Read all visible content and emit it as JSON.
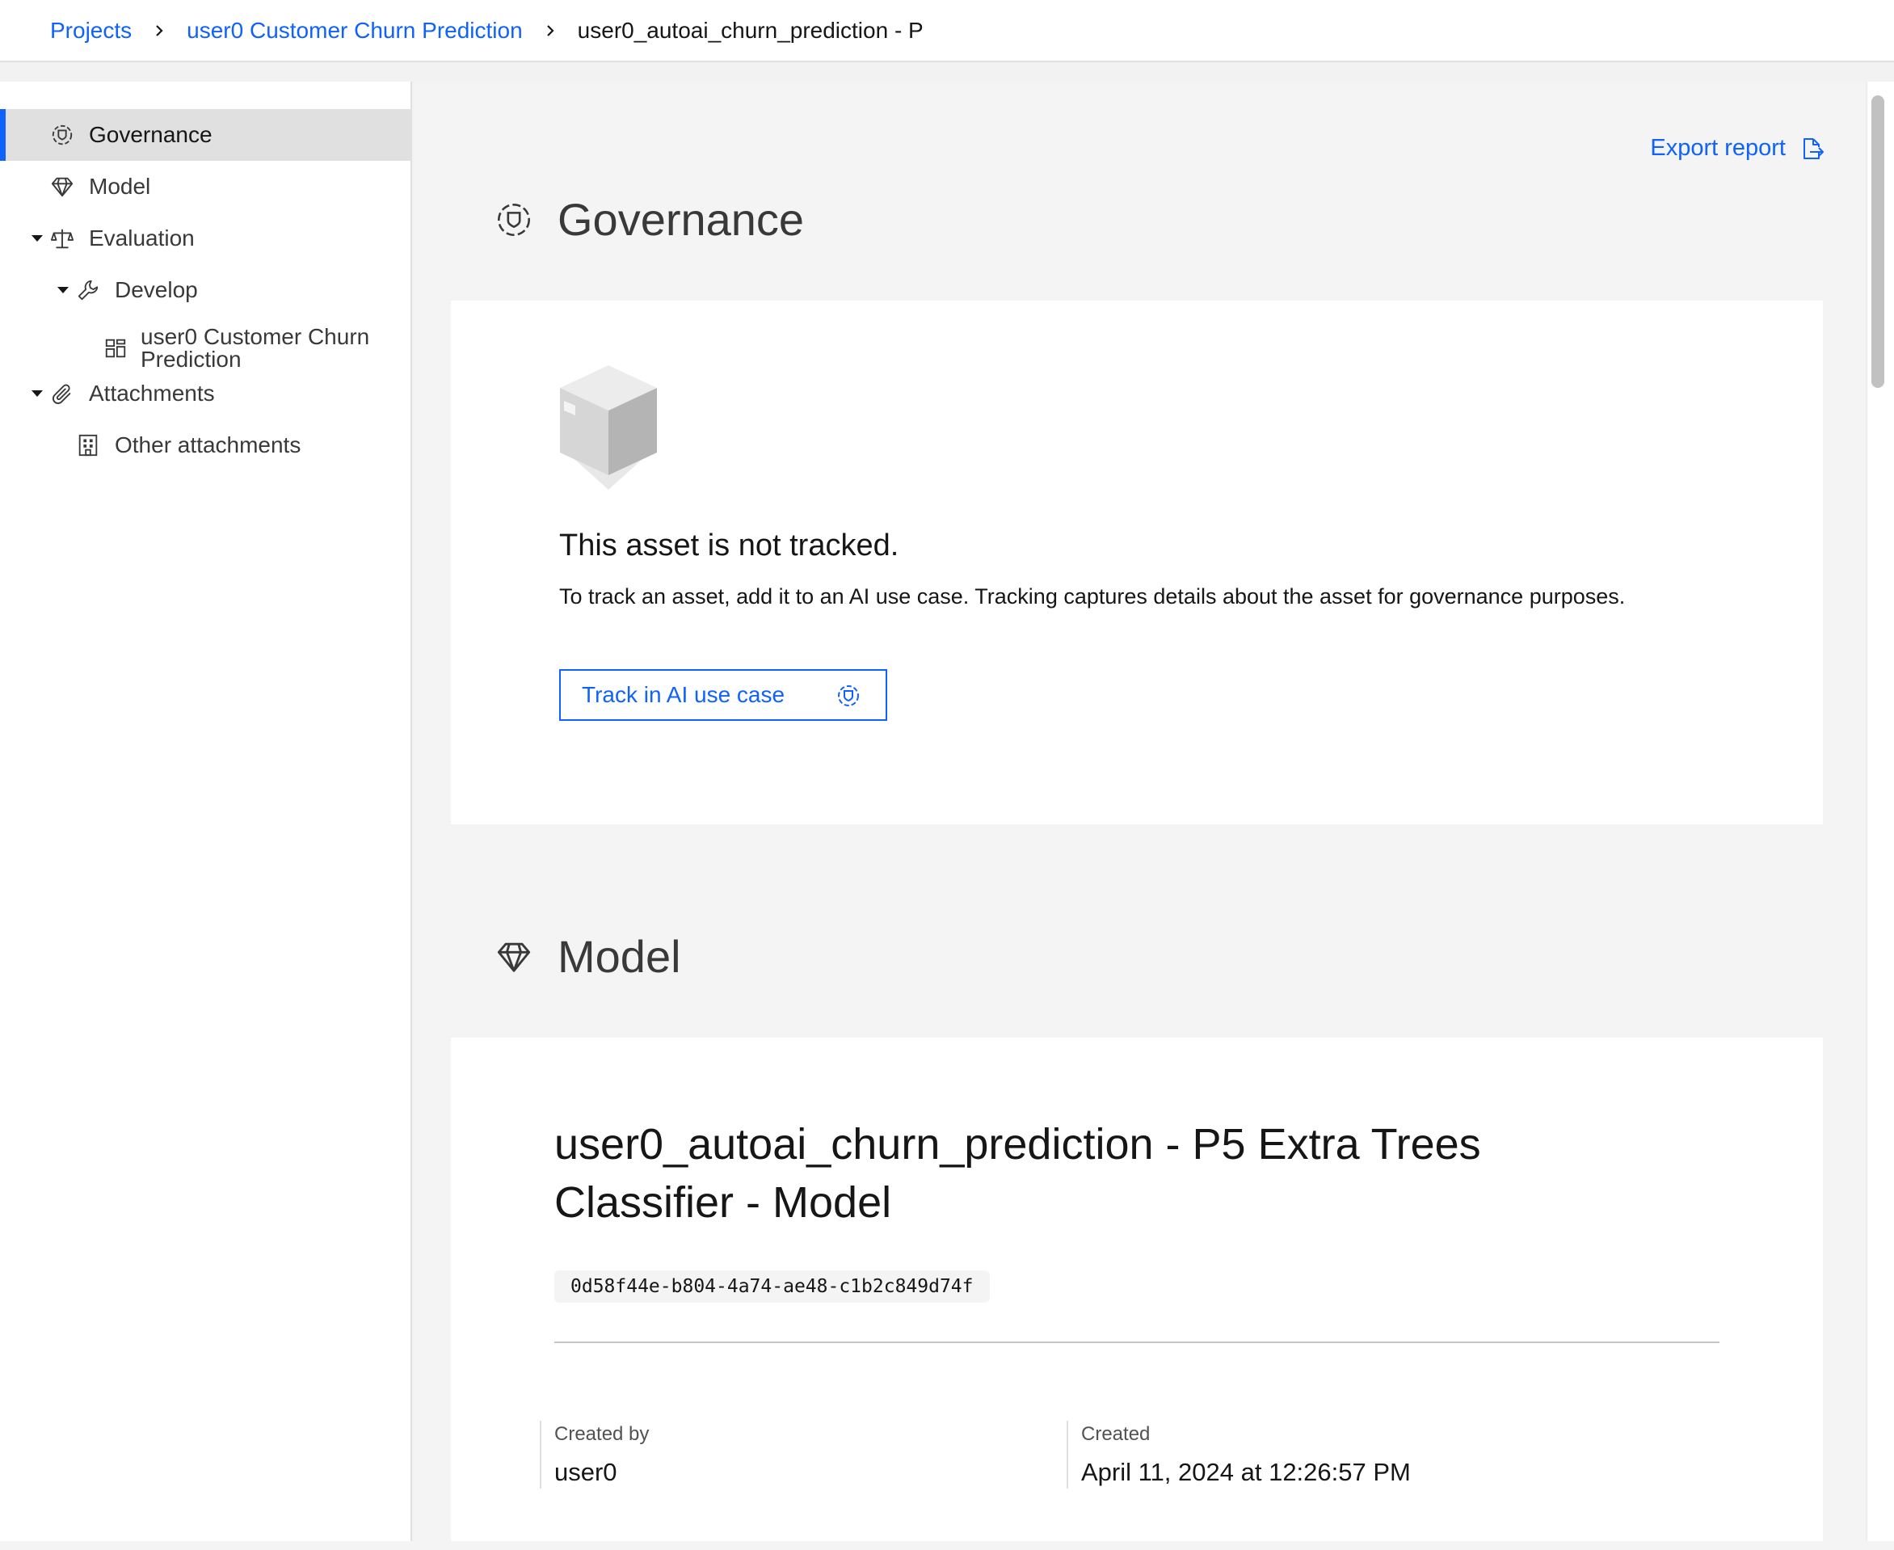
{
  "breadcrumb": {
    "items": [
      {
        "label": "Projects"
      },
      {
        "label": "user0 Customer Churn Prediction"
      }
    ],
    "current": "user0_autoai_churn_prediction - P"
  },
  "sidebar": {
    "items": [
      {
        "label": "Governance",
        "icon": "governance-icon",
        "active": true
      },
      {
        "label": "Model",
        "icon": "diamond-icon"
      },
      {
        "label": "Evaluation",
        "icon": "scales-icon",
        "expanded": true
      },
      {
        "label": "Develop",
        "icon": "wrench-icon",
        "expanded": true
      },
      {
        "label": "user0 Customer Churn Prediction",
        "icon": "dashboard-icon"
      },
      {
        "label": "Attachments",
        "icon": "paperclip-icon",
        "expanded": true
      },
      {
        "label": "Other attachments",
        "icon": "building-icon"
      }
    ]
  },
  "main": {
    "export_label": "Export report",
    "governance": {
      "title": "Governance",
      "empty_title": "This asset is not tracked.",
      "empty_desc": "To track an asset, add it to an AI use case. Tracking captures details about the asset for governance purposes.",
      "track_label": "Track in AI use case"
    },
    "model": {
      "title": "Model",
      "name": "user0_autoai_churn_prediction - P5 Extra Trees Classifier - Model",
      "id": "0d58f44e-b804-4a74-ae48-c1b2c849d74f",
      "created_by_label": "Created by",
      "created_by": "user0",
      "created_label": "Created",
      "created": "April 11, 2024 at 12:26:57 PM"
    }
  },
  "colors": {
    "accent": "#0f62fe",
    "page_bg": "#f4f4f4",
    "card_bg": "#ffffff",
    "text": "#161616"
  }
}
